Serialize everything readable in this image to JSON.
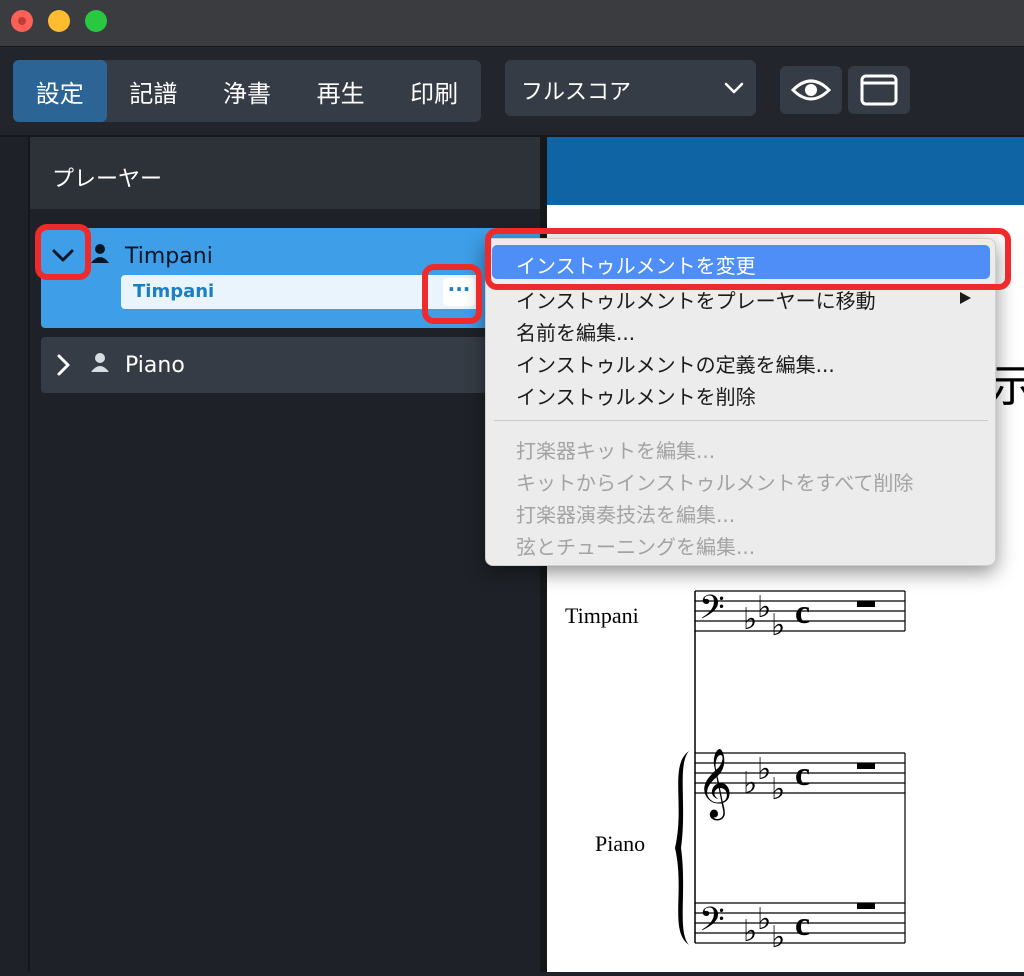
{
  "window": {
    "title": ""
  },
  "toolbar": {
    "tabs": [
      {
        "label": "設定",
        "active": true
      },
      {
        "label": "記譜",
        "active": false
      },
      {
        "label": "浄書",
        "active": false
      },
      {
        "label": "再生",
        "active": false
      },
      {
        "label": "印刷",
        "active": false
      }
    ],
    "layout_select": "フルスコア",
    "buttons": [
      {
        "icon": "eye-icon"
      },
      {
        "icon": "window-icon"
      }
    ]
  },
  "players_panel": {
    "title": "プレーヤー",
    "players": [
      {
        "name": "Timpani",
        "expanded": true,
        "instrument": "Timpani"
      },
      {
        "name": "Piano",
        "expanded": false
      }
    ]
  },
  "context_menu": {
    "items": [
      {
        "label": "インストゥルメントを変更",
        "highlighted": true
      },
      {
        "label": "インストゥルメントをプレーヤーに移動",
        "submenu": true
      },
      {
        "label": "名前を編集..."
      },
      {
        "label": "インストゥルメントの定義を編集..."
      },
      {
        "label": "インストゥルメントを削除"
      }
    ],
    "disabled_items": [
      {
        "label": "打楽器キットを編集..."
      },
      {
        "label": "キットからインストゥルメントをすべて削除"
      },
      {
        "label": "打楽器演奏技法を編集..."
      },
      {
        "label": "弦とチューニングを編集..."
      }
    ]
  },
  "score": {
    "title_fragment": "示",
    "staff_labels": [
      "Timpani",
      "Piano"
    ],
    "time_signature": "c"
  },
  "colors": {
    "accent": "#2c6496",
    "selection": "#3e9ee8",
    "menu_highlight": "#4f8ef7",
    "annotation": "#f0292a"
  }
}
